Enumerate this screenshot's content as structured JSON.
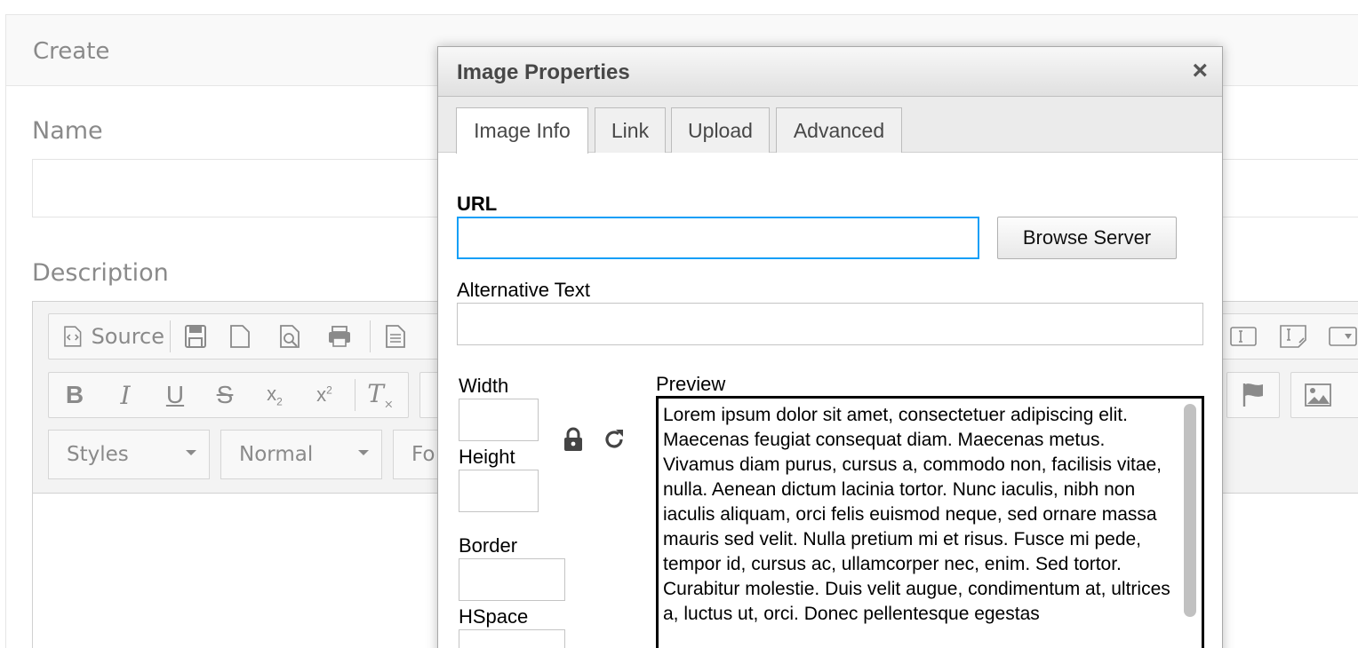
{
  "page": {
    "panel_title": "Create",
    "name_label": "Name",
    "description_label": "Description"
  },
  "toolbar": {
    "source_label": "Source",
    "styles_label": "Styles",
    "format_label": "Normal",
    "font_label": "Fo"
  },
  "dialog": {
    "title": "Image Properties",
    "close": "×",
    "tabs": [
      "Image Info",
      "Link",
      "Upload",
      "Advanced"
    ],
    "url_label": "URL",
    "url_value": "",
    "browse_button": "Browse Server",
    "alt_label": "Alternative Text",
    "alt_value": "",
    "width_label": "Width",
    "height_label": "Height",
    "border_label": "Border",
    "hspace_label": "HSpace",
    "preview_label": "Preview",
    "preview_text": "Lorem ipsum dolor sit amet, consectetuer adipiscing elit. Maecenas feugiat consequat diam. Maecenas metus. Vivamus diam purus, cursus a, commodo non, facilisis vitae, nulla. Aenean dictum lacinia tortor. Nunc iaculis, nibh non iaculis aliquam, orci felis euismod neque, sed ornare massa mauris sed velit. Nulla pretium mi et risus. Fusce mi pede, tempor id, cursus ac, ullamcorper nec, enim. Sed tortor. Curabitur molestie. Duis velit augue, condimentum at, ultrices a, luctus ut, orci. Donec pellentesque egestas"
  },
  "colors": {
    "focus_border": "#139ff7",
    "muted_text": "#8a8a8a"
  }
}
